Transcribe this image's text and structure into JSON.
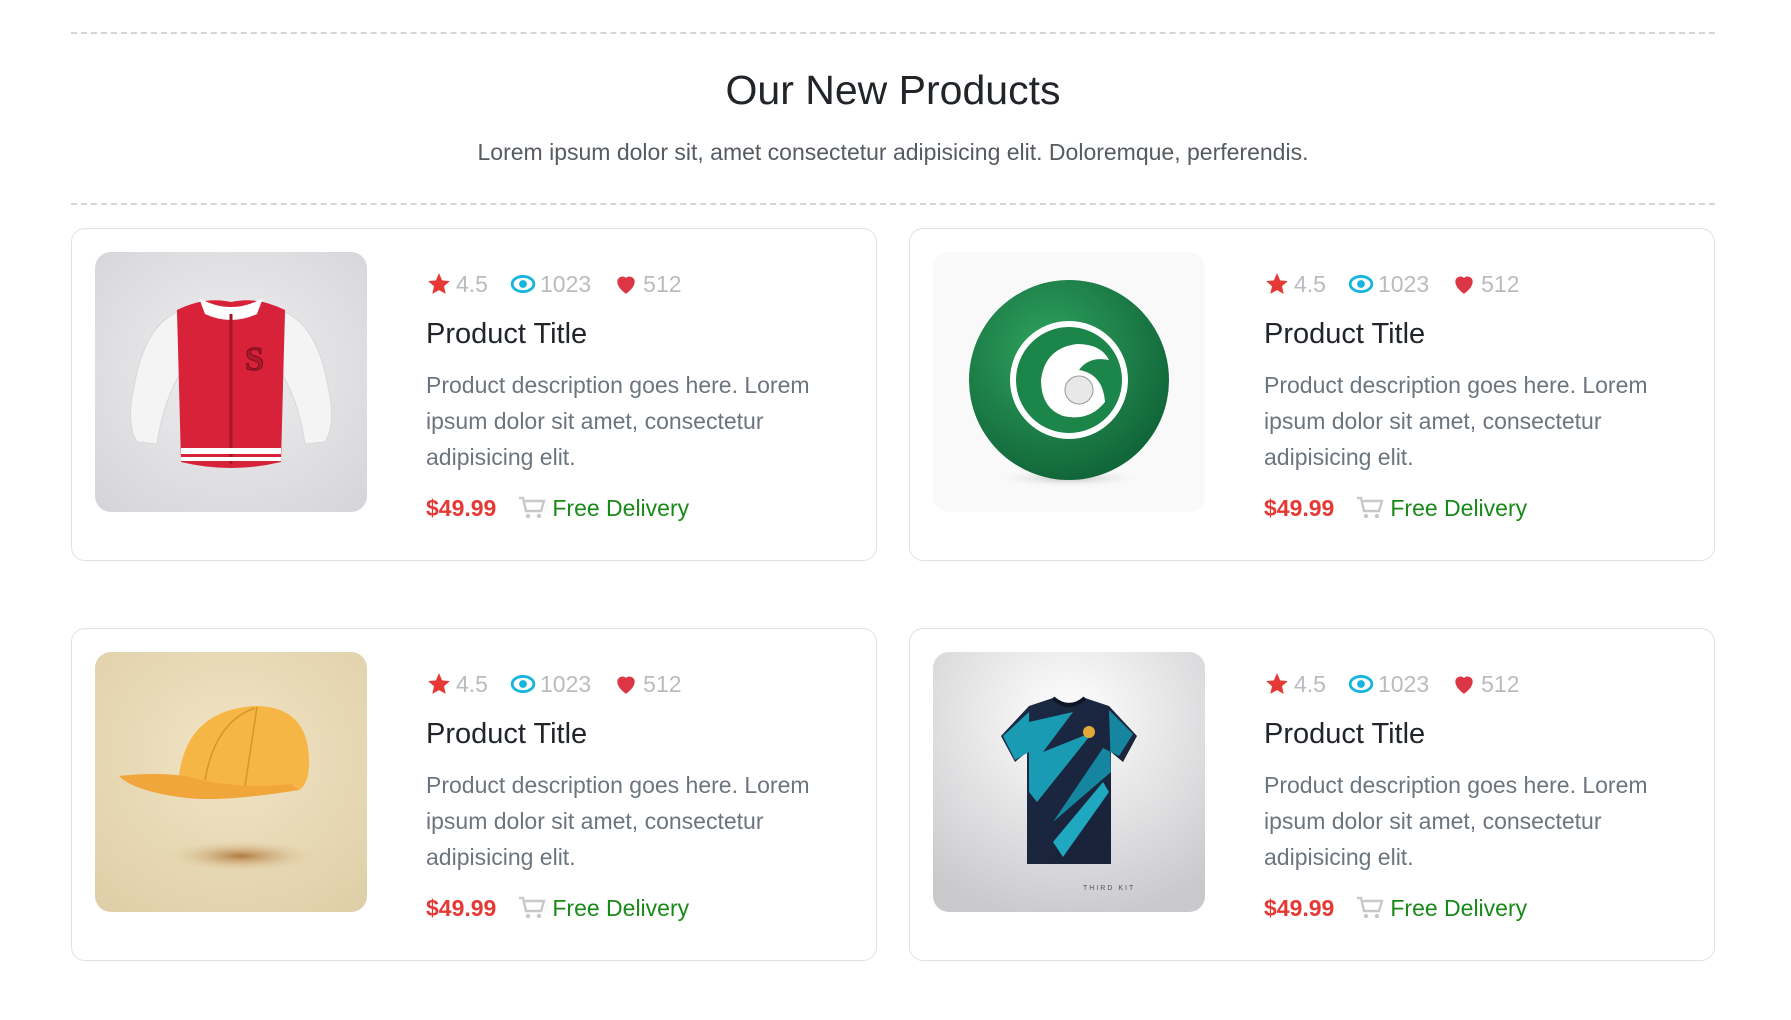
{
  "section": {
    "title": "Our New Products",
    "subtitle": "Lorem ipsum dolor sit, amet consectetur adipisicing elit. Doloremque, perferendis."
  },
  "colors": {
    "rating_star": "#e53935",
    "views_eye": "#17b5de",
    "likes_heart": "#dc3545",
    "price": "#e53935",
    "delivery": "#198a19"
  },
  "products": [
    {
      "image": "red-varsity-jacket",
      "rating": "4.5",
      "views": "1023",
      "likes": "512",
      "title": "Product Title",
      "description": "Product description goes here. Lorem ipsum dolor sit amet, consectetur adipisicing elit.",
      "price": "$49.99",
      "delivery": "Free Delivery"
    },
    {
      "image": "green-soccer-ball",
      "rating": "4.5",
      "views": "1023",
      "likes": "512",
      "title": "Product Title",
      "description": "Product description goes here. Lorem ipsum dolor sit amet, consectetur adipisicing elit.",
      "price": "$49.99",
      "delivery": "Free Delivery"
    },
    {
      "image": "yellow-cap",
      "rating": "4.5",
      "views": "1023",
      "likes": "512",
      "title": "Product Title",
      "description": "Product description goes here. Lorem ipsum dolor sit amet, consectetur adipisicing elit.",
      "price": "$49.99",
      "delivery": "Free Delivery"
    },
    {
      "image": "teal-football-jersey",
      "rating": "4.5",
      "views": "1023",
      "likes": "512",
      "title": "Product Title",
      "description": "Product description goes here. Lorem ipsum dolor sit amet, consectetur adipisicing elit.",
      "price": "$49.99",
      "delivery": "Free Delivery"
    }
  ]
}
